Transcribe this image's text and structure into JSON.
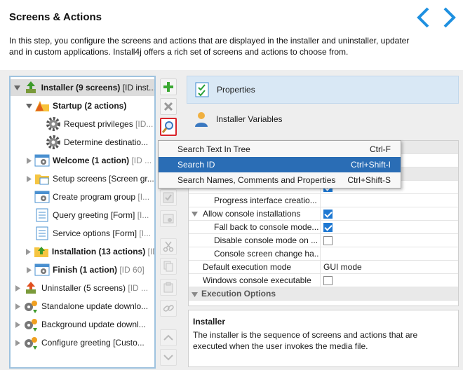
{
  "header": {
    "title": "Screens & Actions",
    "description": "In this step, you configure the screens and actions that are displayed in the installer and uninstaller, updater and in custom applications. Install4j offers a rich set of screens and actions to choose from."
  },
  "tree": [
    {
      "bold": "Installer",
      "rest": " (9 screens)",
      "tail": " [ID inst..."
    },
    {
      "bold": "Startup",
      "rest": " (2 actions)",
      "tail": ""
    },
    {
      "bold": "",
      "rest": "Request privileges",
      "tail": " [ID..."
    },
    {
      "bold": "",
      "rest": "Determine destinatio...",
      "tail": ""
    },
    {
      "bold": "Welcome",
      "rest": " (1 action)",
      "tail": " [ID ..."
    },
    {
      "bold": "",
      "rest": "Setup screens [Screen gr...",
      "tail": ""
    },
    {
      "bold": "",
      "rest": "Create program group",
      "tail": " [I..."
    },
    {
      "bold": "",
      "rest": "Query greeting [Form]",
      "tail": " [I..."
    },
    {
      "bold": "",
      "rest": "Service options [Form]",
      "tail": " [I..."
    },
    {
      "bold": "Installation",
      "rest": " (13 actions)",
      "tail": " [ID..."
    },
    {
      "bold": "Finish",
      "rest": " (1 action)",
      "tail": " [ID 60]"
    },
    {
      "bold": "",
      "rest": "Uninstaller (5 screens)",
      "tail": " [ID ..."
    },
    {
      "bold": "",
      "rest": "Standalone update downlo...",
      "tail": ""
    },
    {
      "bold": "",
      "rest": "Background update downl...",
      "tail": ""
    },
    {
      "bold": "",
      "rest": "Configure greeting [Custo...",
      "tail": ""
    }
  ],
  "right_tabs": {
    "properties": "Properties",
    "installer_variables": "Installer Variables"
  },
  "popup_menu": [
    {
      "label": "Search Text In Tree",
      "shortcut": "Ctrl-F"
    },
    {
      "label": "Search ID",
      "shortcut": "Ctrl+Shift-I"
    },
    {
      "label": "Search Names, Comments and Properties",
      "shortcut": "Ctrl+Shift-S"
    }
  ],
  "grid": {
    "progress_interface": "Progress interface creatio...",
    "allow_console": "Allow console installations",
    "fall_back": "Fall back to console mode...",
    "disable_console": "Disable console mode on ...",
    "console_change": "Console screen change ha...",
    "default_exec_mode": "Default execution mode",
    "default_exec_mode_value": "GUI mode",
    "windows_console": "Windows console executable",
    "execution_options": "Execution Options"
  },
  "description": {
    "title": "Installer",
    "text": "The installer is the sequence of screens and actions that are executed when the user invokes the media file."
  },
  "colors": {
    "selection": "#2a6db5",
    "accent_blue": "#1e90e0",
    "highlight_border": "#d9242b"
  }
}
